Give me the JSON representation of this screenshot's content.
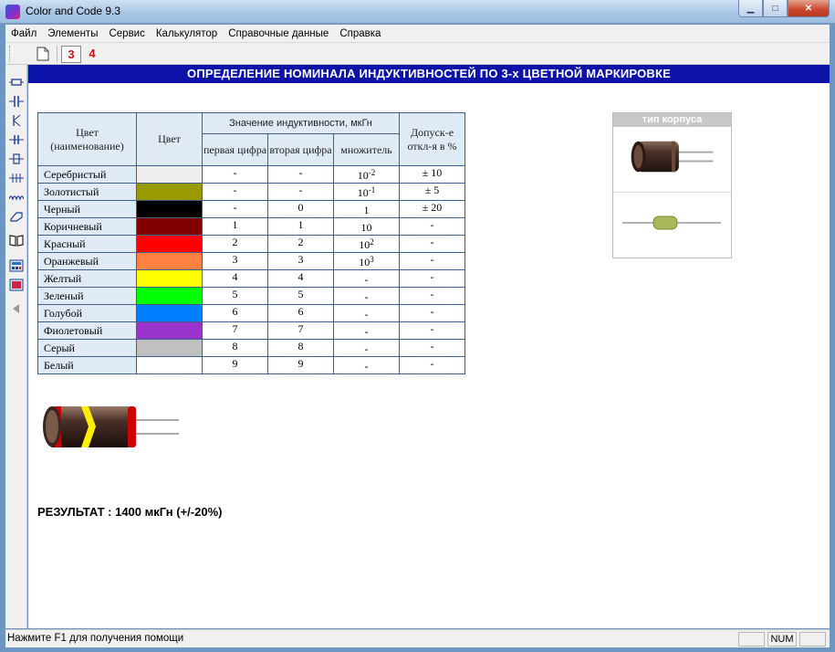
{
  "window": {
    "title": "Color and Code 9.3"
  },
  "menu": {
    "items": [
      "Файл",
      "Элементы",
      "Сервис",
      "Калькулятор",
      "Справочные данные",
      "Справка"
    ]
  },
  "toolbar": {
    "tabs": [
      "3",
      "4"
    ]
  },
  "banner": {
    "text": "ОПРЕДЕЛЕНИЕ НОМИНАЛА ИНДУКТИВНОСТЕЙ ПО 3-х ЦВЕТНОЙ МАРКИРОВКЕ"
  },
  "table": {
    "headers": {
      "name": "Цвет (наименование)",
      "color": "Цвет",
      "group": "Значение индуктивности, мкГн",
      "first": "первая цифра",
      "second": "вторая цифра",
      "multiplier": "множитель",
      "tolerance": "Допуск-е откл-я в %"
    },
    "rows": [
      {
        "name": "Серебристый",
        "color": "#efefef",
        "first": "-",
        "second": "-",
        "mult_base": "10",
        "mult_exp": "-2",
        "tol": "± 10"
      },
      {
        "name": "Золотистый",
        "color": "#999900",
        "first": "-",
        "second": "-",
        "mult_base": "10",
        "mult_exp": "-1",
        "tol": "± 5"
      },
      {
        "name": "Черный",
        "color": "#000000",
        "first": "-",
        "second": "0",
        "mult_base": "1",
        "mult_exp": "",
        "tol": "± 20"
      },
      {
        "name": "Коричневый",
        "color": "#800000",
        "first": "1",
        "second": "1",
        "mult_base": "10",
        "mult_exp": "",
        "tol": "-"
      },
      {
        "name": "Красный",
        "color": "#ff0000",
        "first": "2",
        "second": "2",
        "mult_base": "10",
        "mult_exp": "2",
        "tol": "-"
      },
      {
        "name": "Оранжевый",
        "color": "#ff8040",
        "first": "3",
        "second": "3",
        "mult_base": "10",
        "mult_exp": "3",
        "tol": "-"
      },
      {
        "name": "Желтый",
        "color": "#ffff00",
        "first": "4",
        "second": "4",
        "mult_base": "-",
        "mult_exp": "",
        "tol": "-"
      },
      {
        "name": "Зеленый",
        "color": "#00ff00",
        "first": "5",
        "second": "5",
        "mult_base": "-",
        "mult_exp": "",
        "tol": "-"
      },
      {
        "name": "Голубой",
        "color": "#0080ff",
        "first": "6",
        "second": "6",
        "mult_base": "-",
        "mult_exp": "",
        "tol": "-"
      },
      {
        "name": "Фиолетовый",
        "color": "#9933cc",
        "first": "7",
        "second": "7",
        "mult_base": "-",
        "mult_exp": "",
        "tol": "-"
      },
      {
        "name": "Серый",
        "color": "#c0c0c0",
        "first": "8",
        "second": "8",
        "mult_base": "-",
        "mult_exp": "",
        "tol": "-"
      },
      {
        "name": "Белый",
        "color": "#ffffff",
        "first": "9",
        "second": "9",
        "mult_base": "-",
        "mult_exp": "",
        "tol": "-"
      }
    ]
  },
  "body_panel": {
    "title": "тип корпуса"
  },
  "inductor_preview": {
    "bands": [
      "#cc0000",
      "#ffee00",
      "#cc0000"
    ]
  },
  "result": {
    "text": "РЕЗУЛЬТАТ : 1400 мкГн (+/-20%)"
  },
  "status": {
    "help": "Нажмите F1 для получения помощи",
    "num": "NUM"
  },
  "colors": {
    "banner": "#0d13a8",
    "header_bg": "#e0eaf4",
    "tab_text": "#cc1111"
  },
  "icons": [
    "resistor-icon",
    "capacitor-icon",
    "diode-icon",
    "inductor-icon",
    "coil-icon",
    "crystal-icon",
    "wire-icon",
    "eraser-icon",
    "book-icon",
    "calculator-icon",
    "calc2-icon",
    "arrow-left-icon"
  ]
}
